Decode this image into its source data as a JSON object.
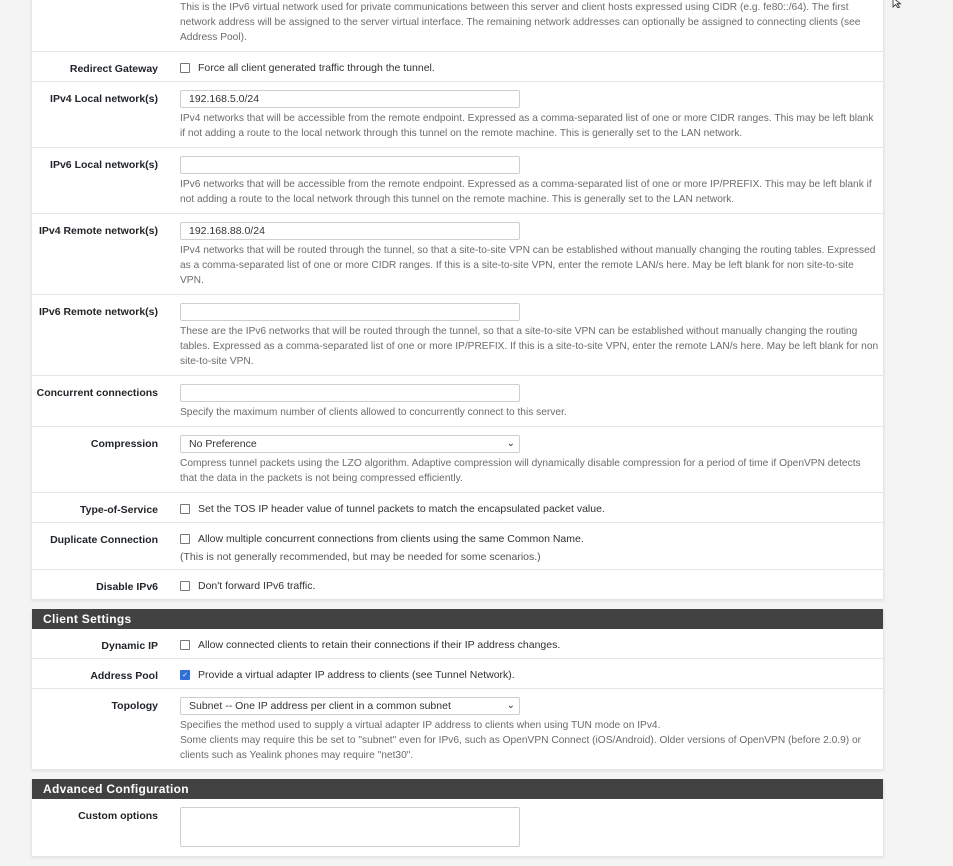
{
  "top_help": "This is the IPv6 virtual network used for private communications between this server and client hosts expressed using CIDR (e.g. fe80::/64). The first network address will be assigned to the server virtual interface. The remaining network addresses can optionally be assigned to connecting clients (see Address Pool).",
  "tunnel_settings": {
    "redirect_gateway": {
      "label": "Redirect Gateway",
      "checkbox_label": "Force all client generated traffic through the tunnel.",
      "checked": false
    },
    "ipv4_local": {
      "label": "IPv4 Local network(s)",
      "value": "192.168.5.0/24",
      "help": "IPv4 networks that will be accessible from the remote endpoint. Expressed as a comma-separated list of one or more CIDR ranges. This may be left blank if not adding a route to the local network through this tunnel on the remote machine. This is generally set to the LAN network."
    },
    "ipv6_local": {
      "label": "IPv6 Local network(s)",
      "value": "",
      "help": "IPv6 networks that will be accessible from the remote endpoint. Expressed as a comma-separated list of one or more IP/PREFIX. This may be left blank if not adding a route to the local network through this tunnel on the remote machine. This is generally set to the LAN network."
    },
    "ipv4_remote": {
      "label": "IPv4 Remote network(s)",
      "value": "192.168.88.0/24",
      "help": "IPv4 networks that will be routed through the tunnel, so that a site-to-site VPN can be established without manually changing the routing tables. Expressed as a comma-separated list of one or more CIDR ranges. If this is a site-to-site VPN, enter the remote LAN/s here. May be left blank for non site-to-site VPN."
    },
    "ipv6_remote": {
      "label": "IPv6 Remote network(s)",
      "value": "",
      "help": "These are the IPv6 networks that will be routed through the tunnel, so that a site-to-site VPN can be established without manually changing the routing tables. Expressed as a comma-separated list of one or more IP/PREFIX. If this is a site-to-site VPN, enter the remote LAN/s here. May be left blank for non site-to-site VPN."
    },
    "concurrent": {
      "label": "Concurrent connections",
      "value": "",
      "help": "Specify the maximum number of clients allowed to concurrently connect to this server."
    },
    "compression": {
      "label": "Compression",
      "selected": "No Preference",
      "help": "Compress tunnel packets using the LZO algorithm. Adaptive compression will dynamically disable compression for a period of time if OpenVPN detects that the data in the packets is not being compressed efficiently."
    },
    "tos": {
      "label": "Type-of-Service",
      "checkbox_label": "Set the TOS IP header value of tunnel packets to match the encapsulated packet value.",
      "checked": false
    },
    "duplicate": {
      "label": "Duplicate Connection",
      "checkbox_label": "Allow multiple concurrent connections from clients using the same Common Name.",
      "note": "(This is not generally recommended, but may be needed for some scenarios.)",
      "checked": false
    },
    "disable_ipv6": {
      "label": "Disable IPv6",
      "checkbox_label": "Don't forward IPv6 traffic.",
      "checked": false
    }
  },
  "client_settings": {
    "title": "Client Settings",
    "dynamic_ip": {
      "label": "Dynamic IP",
      "checkbox_label": "Allow connected clients to retain their connections if their IP address changes.",
      "checked": false
    },
    "address_pool": {
      "label": "Address Pool",
      "checkbox_label": "Provide a virtual adapter IP address to clients (see Tunnel Network).",
      "checked": true
    },
    "topology": {
      "label": "Topology",
      "selected": "Subnet -- One IP address per client in a common subnet",
      "help1": "Specifies the method used to supply a virtual adapter IP address to clients when using TUN mode on IPv4.",
      "help2": "Some clients may require this be set to \"subnet\" even for IPv6, such as OpenVPN Connect (iOS/Android). Older versions of OpenVPN (before 2.0.9) or clients such as Yealink phones may require \"net30\"."
    }
  },
  "advanced": {
    "title": "Advanced Configuration",
    "custom_options": {
      "label": "Custom options",
      "value": ""
    }
  },
  "icons": {
    "chevron": "⌄",
    "check": "✓"
  },
  "colors": {
    "header_bg": "#424242",
    "checkbox_checked": "#2f6fd8",
    "page_bg": "#f4f4f4"
  }
}
